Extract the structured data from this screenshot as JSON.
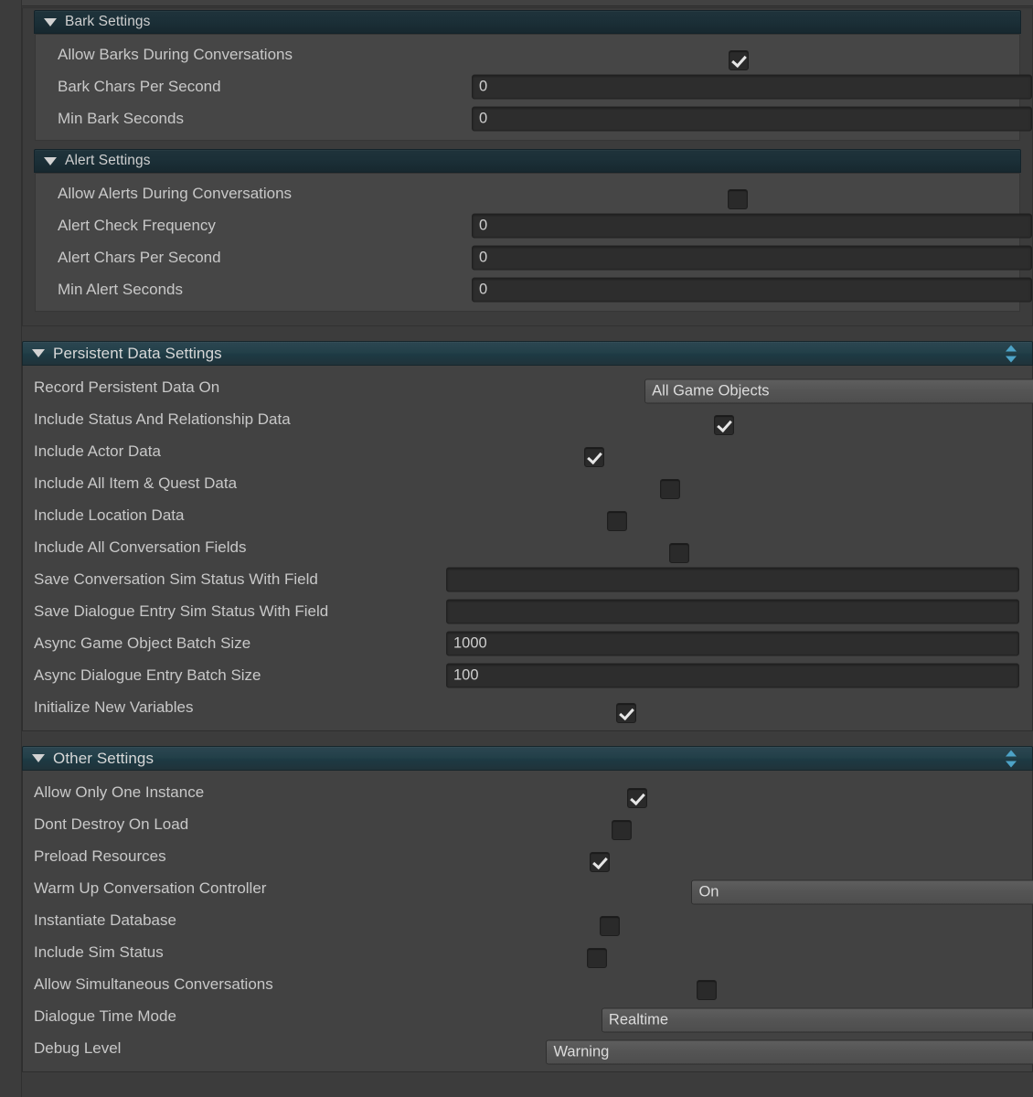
{
  "sections": [
    {
      "id": "bark-settings",
      "kind": "nested",
      "title": "Bark Settings",
      "expanded": true,
      "rows": [
        {
          "label": "Allow Barks During Conversations",
          "control": "checkbox",
          "checked": true
        },
        {
          "label": "Bark Chars Per Second",
          "control": "field",
          "value": "0"
        },
        {
          "label": "Min Bark Seconds",
          "control": "field",
          "value": "0"
        }
      ]
    },
    {
      "id": "alert-settings",
      "kind": "nested",
      "title": "Alert Settings",
      "expanded": true,
      "rows": [
        {
          "label": "Allow Alerts During Conversations",
          "control": "checkbox",
          "checked": false
        },
        {
          "label": "Alert Check Frequency",
          "control": "field",
          "value": "0"
        },
        {
          "label": "Alert Chars Per Second",
          "control": "field",
          "value": "0"
        },
        {
          "label": "Min Alert Seconds",
          "control": "field",
          "value": "0"
        }
      ]
    },
    {
      "id": "persistent-data-settings",
      "kind": "top",
      "title": "Persistent Data Settings",
      "expanded": true,
      "sort_widget": true,
      "rows": [
        {
          "label": "Record Persistent Data On",
          "control": "dropdown",
          "value": "All Game Objects"
        },
        {
          "label": "Include Status And Relationship Data",
          "control": "checkbox",
          "checked": true
        },
        {
          "label": "Include Actor Data",
          "control": "checkbox",
          "checked": true
        },
        {
          "label": "Include All Item & Quest Data",
          "control": "checkbox",
          "checked": false
        },
        {
          "label": "Include Location Data",
          "control": "checkbox",
          "checked": false
        },
        {
          "label": "Include All Conversation Fields",
          "control": "checkbox",
          "checked": false
        },
        {
          "label": "Save Conversation Sim Status With Field",
          "control": "field",
          "value": ""
        },
        {
          "label": "Save Dialogue Entry Sim Status With Field",
          "control": "field",
          "value": ""
        },
        {
          "label": "Async Game Object Batch Size",
          "control": "field",
          "value": "1000"
        },
        {
          "label": "Async Dialogue Entry Batch Size",
          "control": "field",
          "value": "100"
        },
        {
          "label": "Initialize New Variables",
          "control": "checkbox",
          "checked": true
        }
      ]
    },
    {
      "id": "other-settings",
      "kind": "top",
      "title": "Other Settings",
      "expanded": true,
      "sort_widget": true,
      "rows": [
        {
          "label": "Allow Only One Instance",
          "control": "checkbox",
          "checked": true
        },
        {
          "label": "Dont Destroy On Load",
          "control": "checkbox",
          "checked": false
        },
        {
          "label": "Preload Resources",
          "control": "checkbox",
          "checked": true
        },
        {
          "label": "Warm Up Conversation Controller",
          "control": "dropdown",
          "value": "On"
        },
        {
          "label": "Instantiate Database",
          "control": "checkbox",
          "checked": false
        },
        {
          "label": "Include Sim Status",
          "control": "checkbox",
          "checked": false
        },
        {
          "label": "Allow Simultaneous Conversations",
          "control": "checkbox",
          "checked": false
        },
        {
          "label": "Dialogue Time Mode",
          "control": "dropdown",
          "value": "Realtime"
        },
        {
          "label": "Debug Level",
          "control": "dropdown",
          "value": "Warning"
        }
      ]
    }
  ],
  "icons": {
    "foldout_expanded": "triangle-down-icon",
    "dropdown": "chevron-down-icon",
    "sort": "sort-updown-icon",
    "checkmark": "check-icon"
  },
  "colors": {
    "header_accent": "#234049",
    "sort_arrow": "#4da3c7",
    "panel_bg": "#424242",
    "page_bg": "#3c3c3c",
    "field_bg": "#2d2d2d",
    "dropdown_bg": "#545454",
    "label_text": "#c8c8c8"
  }
}
